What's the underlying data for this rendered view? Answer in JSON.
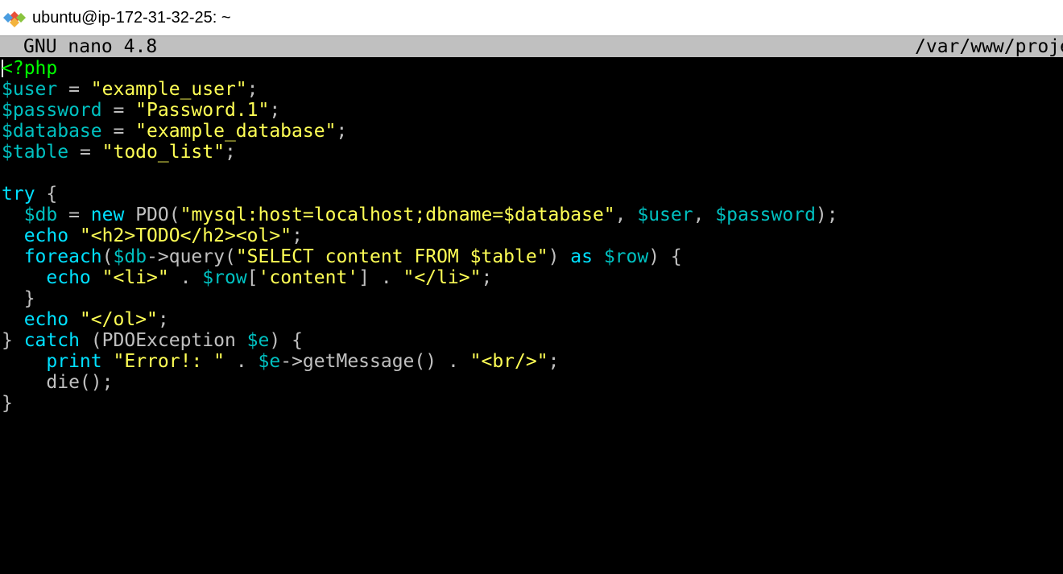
{
  "window": {
    "title": "ubuntu@ip-172-31-32-25: ~",
    "icon": "git-bash-diamond-icon"
  },
  "nano": {
    "version_label": "GNU nano 4.8",
    "filename": "/var/www/proje"
  },
  "colors": {
    "php_tag": "#00ff00",
    "variable": "#00c0c0",
    "string": "#ffff55",
    "keyword": "#00e0ff",
    "plain": "#c0c0c0",
    "header_bg": "#c0c0c0",
    "terminal_bg": "#000000"
  },
  "code": {
    "lines": [
      [
        {
          "t": "<?php",
          "c": "php"
        }
      ],
      [
        {
          "t": "$user",
          "c": "var"
        },
        {
          "t": " = ",
          "c": "plain"
        },
        {
          "t": "\"example_user\"",
          "c": "str"
        },
        {
          "t": ";",
          "c": "plain"
        }
      ],
      [
        {
          "t": "$password",
          "c": "var"
        },
        {
          "t": " = ",
          "c": "plain"
        },
        {
          "t": "\"Password.1\"",
          "c": "str"
        },
        {
          "t": ";",
          "c": "plain"
        }
      ],
      [
        {
          "t": "$database",
          "c": "var"
        },
        {
          "t": " = ",
          "c": "plain"
        },
        {
          "t": "\"example_database\"",
          "c": "str"
        },
        {
          "t": ";",
          "c": "plain"
        }
      ],
      [
        {
          "t": "$table",
          "c": "var"
        },
        {
          "t": " = ",
          "c": "plain"
        },
        {
          "t": "\"todo_list\"",
          "c": "str"
        },
        {
          "t": ";",
          "c": "plain"
        }
      ],
      [],
      [
        {
          "t": "try",
          "c": "kw"
        },
        {
          "t": " {",
          "c": "plain"
        }
      ],
      [
        {
          "t": "  ",
          "c": "plain"
        },
        {
          "t": "$db",
          "c": "var"
        },
        {
          "t": " = ",
          "c": "plain"
        },
        {
          "t": "new",
          "c": "kw"
        },
        {
          "t": " PDO(",
          "c": "plain"
        },
        {
          "t": "\"mysql:host=localhost;dbname=$database\"",
          "c": "str"
        },
        {
          "t": ", ",
          "c": "plain"
        },
        {
          "t": "$user",
          "c": "var"
        },
        {
          "t": ", ",
          "c": "plain"
        },
        {
          "t": "$password",
          "c": "var"
        },
        {
          "t": ");",
          "c": "plain"
        }
      ],
      [
        {
          "t": "  ",
          "c": "plain"
        },
        {
          "t": "echo",
          "c": "kw"
        },
        {
          "t": " ",
          "c": "plain"
        },
        {
          "t": "\"<h2>TODO</h2><ol>\"",
          "c": "str"
        },
        {
          "t": ";",
          "c": "plain"
        }
      ],
      [
        {
          "t": "  ",
          "c": "plain"
        },
        {
          "t": "foreach",
          "c": "kw"
        },
        {
          "t": "(",
          "c": "plain"
        },
        {
          "t": "$db",
          "c": "var"
        },
        {
          "t": "->query(",
          "c": "plain"
        },
        {
          "t": "\"SELECT content FROM $table\"",
          "c": "str"
        },
        {
          "t": ") ",
          "c": "plain"
        },
        {
          "t": "as",
          "c": "kw"
        },
        {
          "t": " ",
          "c": "plain"
        },
        {
          "t": "$row",
          "c": "var"
        },
        {
          "t": ") {",
          "c": "plain"
        }
      ],
      [
        {
          "t": "    ",
          "c": "plain"
        },
        {
          "t": "echo",
          "c": "kw"
        },
        {
          "t": " ",
          "c": "plain"
        },
        {
          "t": "\"<li>\"",
          "c": "str"
        },
        {
          "t": " . ",
          "c": "plain"
        },
        {
          "t": "$row",
          "c": "var"
        },
        {
          "t": "[",
          "c": "plain"
        },
        {
          "t": "'content'",
          "c": "str"
        },
        {
          "t": "] . ",
          "c": "plain"
        },
        {
          "t": "\"</li>\"",
          "c": "str"
        },
        {
          "t": ";",
          "c": "plain"
        }
      ],
      [
        {
          "t": "  }",
          "c": "plain"
        }
      ],
      [
        {
          "t": "  ",
          "c": "plain"
        },
        {
          "t": "echo",
          "c": "kw"
        },
        {
          "t": " ",
          "c": "plain"
        },
        {
          "t": "\"</ol>\"",
          "c": "str"
        },
        {
          "t": ";",
          "c": "plain"
        }
      ],
      [
        {
          "t": "} ",
          "c": "plain"
        },
        {
          "t": "catch",
          "c": "kw"
        },
        {
          "t": " (PDOException ",
          "c": "plain"
        },
        {
          "t": "$e",
          "c": "var"
        },
        {
          "t": ") {",
          "c": "plain"
        }
      ],
      [
        {
          "t": "    ",
          "c": "plain"
        },
        {
          "t": "print",
          "c": "kw"
        },
        {
          "t": " ",
          "c": "plain"
        },
        {
          "t": "\"Error!: \"",
          "c": "str"
        },
        {
          "t": " . ",
          "c": "plain"
        },
        {
          "t": "$e",
          "c": "var"
        },
        {
          "t": "->getMessage() . ",
          "c": "plain"
        },
        {
          "t": "\"<br/>\"",
          "c": "str"
        },
        {
          "t": ";",
          "c": "plain"
        }
      ],
      [
        {
          "t": "    die();",
          "c": "plain"
        }
      ],
      [
        {
          "t": "}",
          "c": "plain"
        }
      ]
    ]
  }
}
